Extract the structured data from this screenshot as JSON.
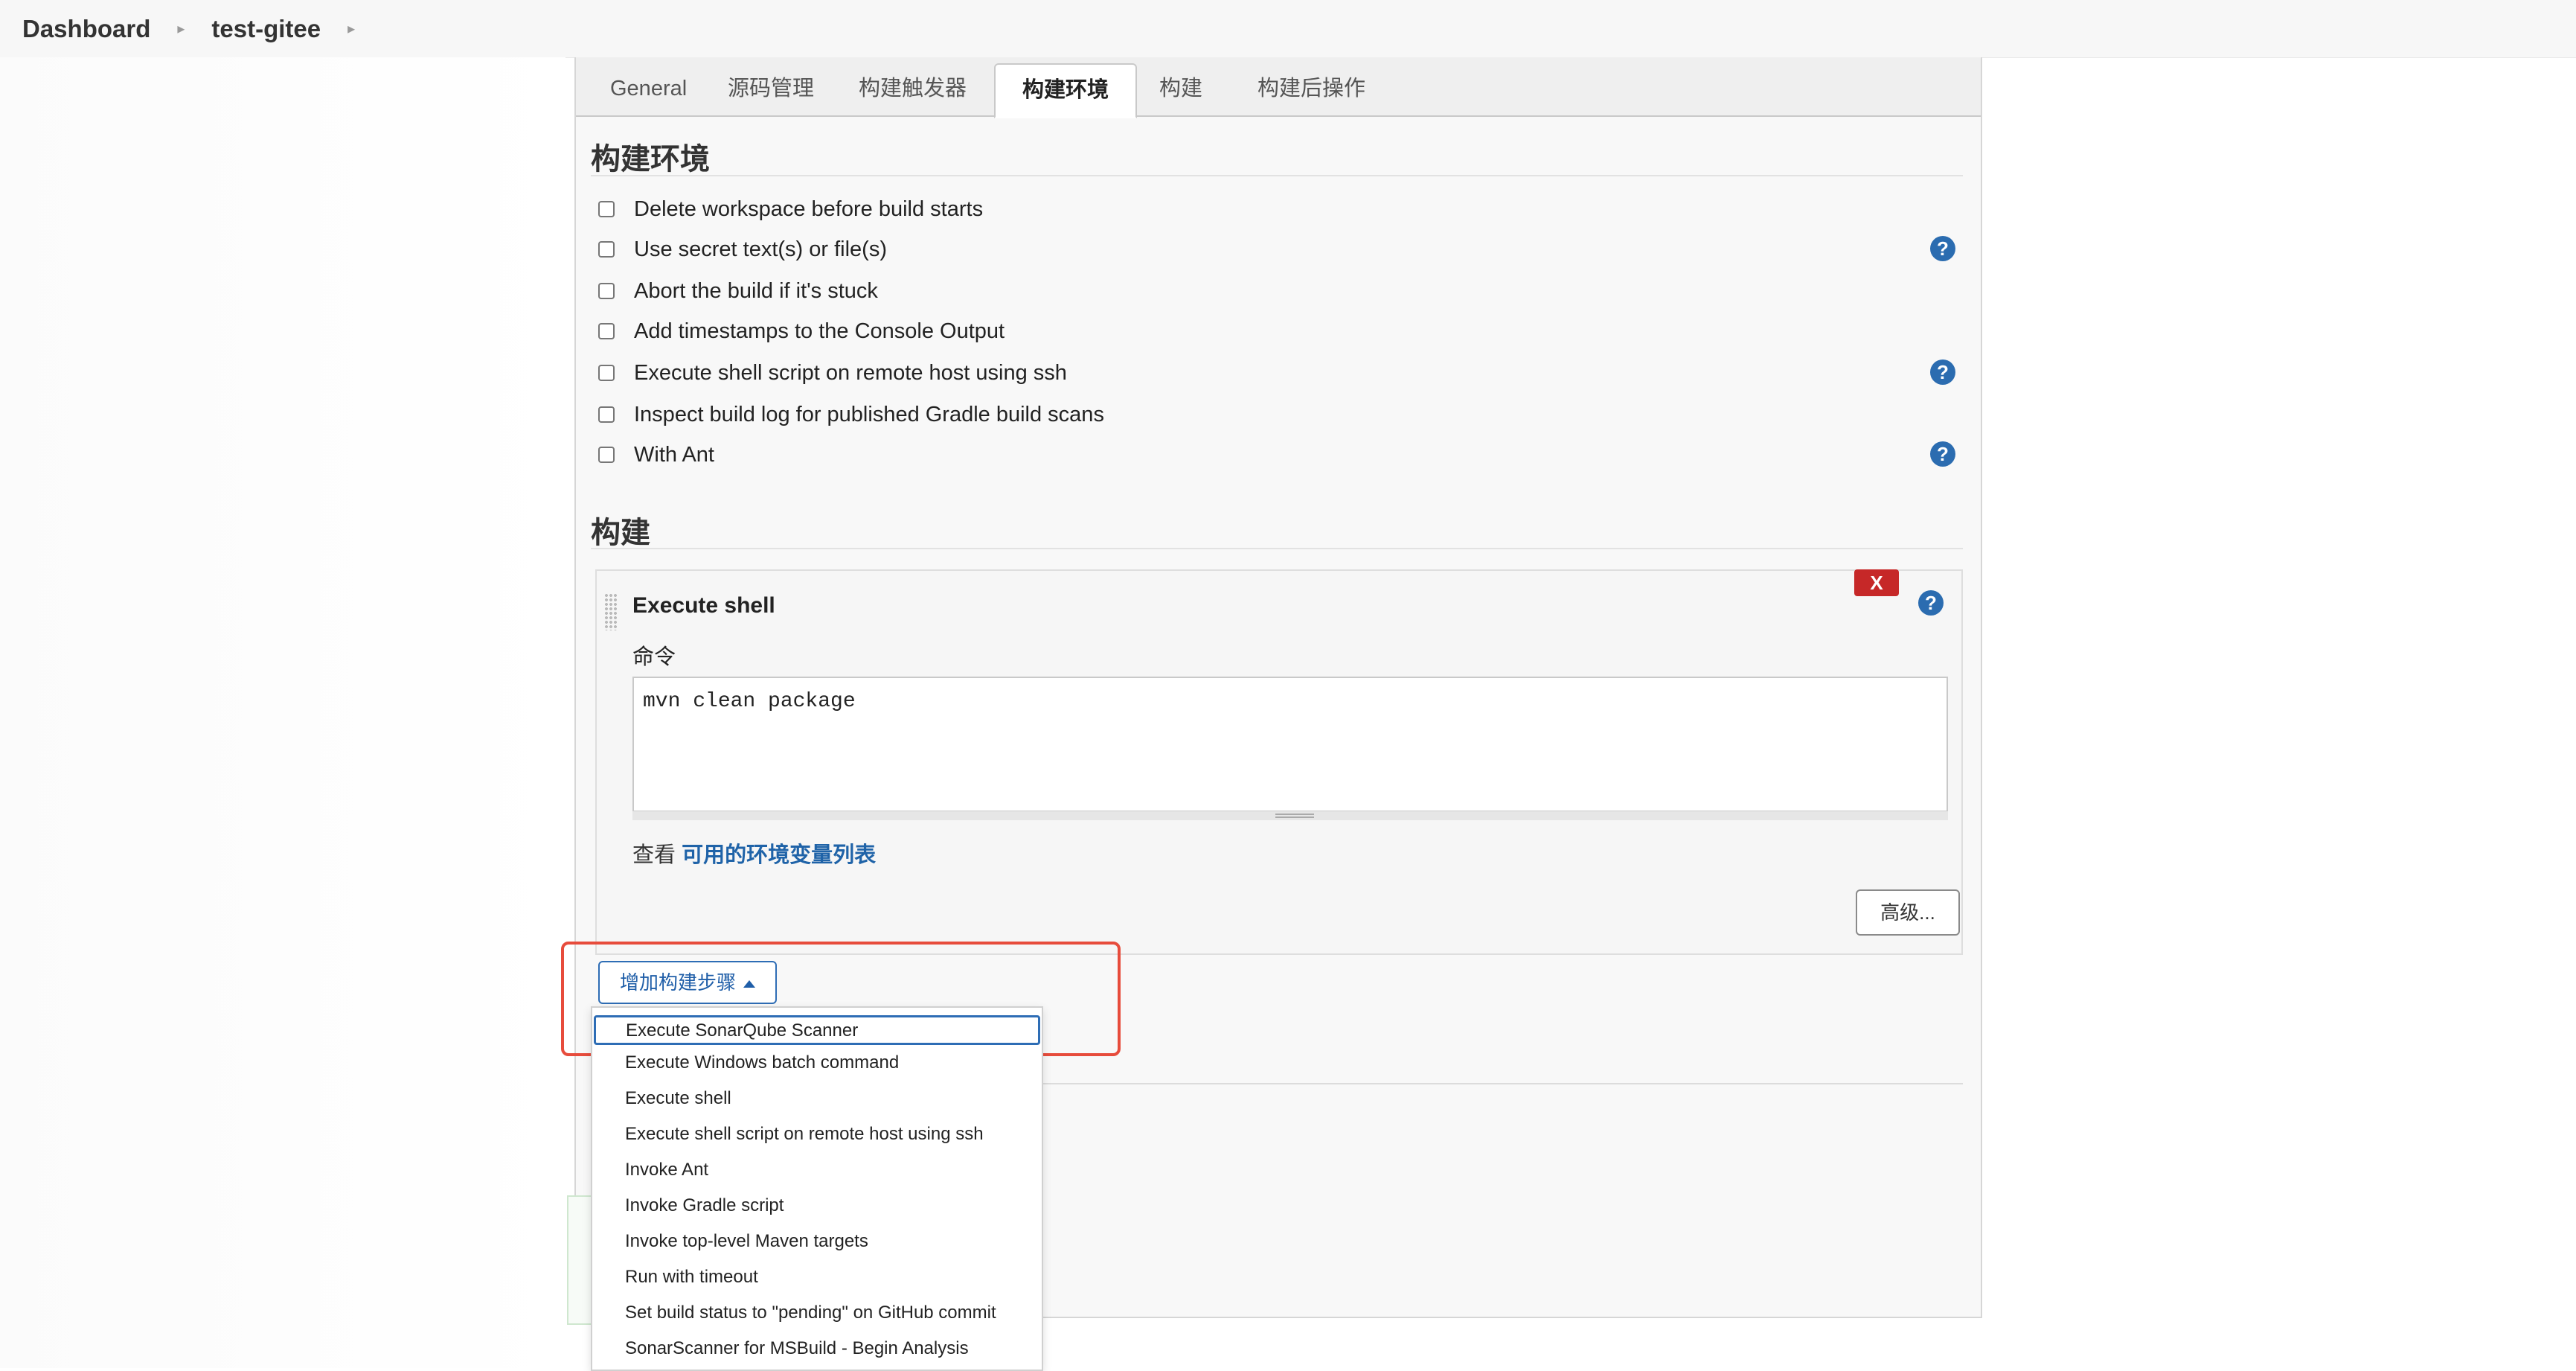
{
  "breadcrumb": {
    "items": [
      "Dashboard",
      "test-gitee"
    ]
  },
  "tabs": [
    "General",
    "源码管理",
    "构建触发器",
    "构建环境",
    "构建",
    "构建后操作"
  ],
  "active_tab": "构建环境",
  "build_env": {
    "title": "构建环境",
    "options": [
      "Delete workspace before build starts",
      "Use secret text(s) or file(s)",
      "Abort the build if it's stuck",
      "Add timestamps to the Console Output",
      "Execute shell script on remote host using ssh",
      "Inspect build log for published Gradle build scans",
      "With Ant"
    ]
  },
  "build": {
    "title": "构建",
    "step": {
      "delete_label": "X",
      "title": "Execute shell",
      "command_label": "命令",
      "command_value": "mvn clean package",
      "env_prefix": "查看",
      "env_link": "可用的环境变量列表",
      "advanced_button": "高级..."
    },
    "add_step_button": "增加构建步骤"
  },
  "help_icon_text": "?",
  "dropdown": {
    "items": [
      "Execute SonarQube Scanner",
      "Execute Windows batch command",
      "Execute shell",
      "Execute shell script on remote host using ssh",
      "Invoke Ant",
      "Invoke Gradle script",
      "Invoke top-level Maven targets",
      "Run with timeout",
      "Set build status to \"pending\" on GitHub commit",
      "SonarScanner for MSBuild - Begin Analysis"
    ],
    "selected": "Execute SonarQube Scanner"
  },
  "colors": {
    "highlight": "#e74c3c",
    "link": "#1f63a8",
    "help_icon": "#2b6cb0",
    "delete_button": "#c62828"
  }
}
